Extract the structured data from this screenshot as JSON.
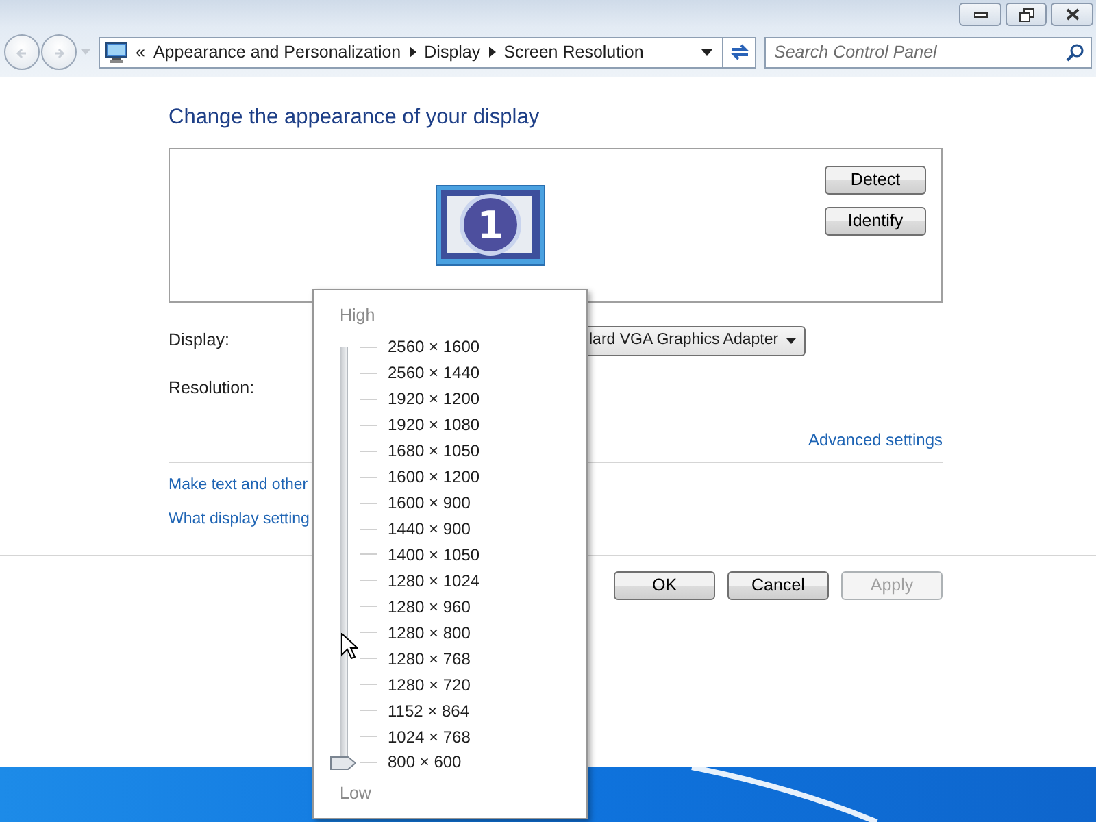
{
  "address_bar": {
    "prefix": "«",
    "crumbs": [
      "Appearance and Personalization",
      "Display",
      "Screen Resolution"
    ]
  },
  "search": {
    "placeholder": "Search Control Panel"
  },
  "heading": "Change the appearance of your display",
  "monitor": {
    "number": "1"
  },
  "display_buttons": [
    "Detect",
    "Identify"
  ],
  "display_field": {
    "label": "Display:",
    "value": "lard VGA Graphics Adapter"
  },
  "resolution_field": {
    "label": "Resolution:"
  },
  "advanced_link": "Advanced settings",
  "links": [
    "Make text and other",
    "What display setting"
  ],
  "dialog_buttons": [
    {
      "label": "OK",
      "disabled": false
    },
    {
      "label": "Cancel",
      "disabled": false
    },
    {
      "label": "Apply",
      "disabled": true
    }
  ],
  "resolution_popup": {
    "high_label": "High",
    "low_label": "Low",
    "level": 0,
    "options": [
      "2560 × 1600",
      "2560 × 1440",
      "1920 × 1200",
      "1920 × 1080",
      "1680 × 1050",
      "1600 × 1200",
      "1600 × 900",
      "1440 × 900",
      "1400 × 1050",
      "1280 × 1024",
      "1280 × 960",
      "1280 × 800",
      "1280 × 768",
      "1280 × 720",
      "1152 × 864",
      "1024 × 768",
      "800 × 600"
    ]
  }
}
